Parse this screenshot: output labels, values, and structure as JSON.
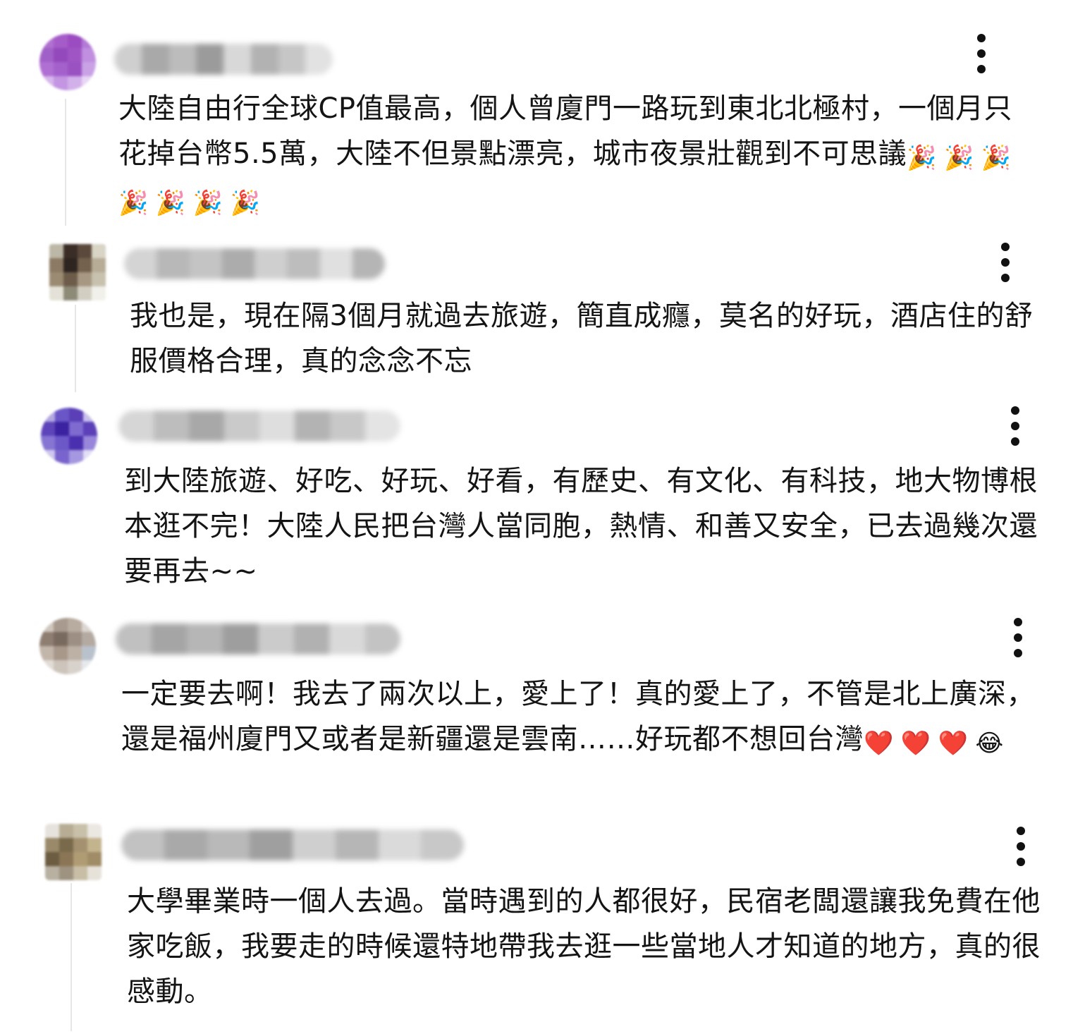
{
  "comments": [
    {
      "text": "大陸自由行全球CP值最高，個人曾廈門一路玩到東北北極村，一個月只花掉台幣5.5萬，大陸不但景點漂亮，城市夜景壯觀到不可思議",
      "emoji": [
        "🎉",
        "🎉",
        "🎉",
        "🎉",
        "🎉",
        "🎉",
        "🎉"
      ]
    },
    {
      "text": "我也是，現在隔3個月就過去旅遊，簡直成癮，莫名的好玩，酒店住的舒服價格合理，真的念念不忘",
      "emoji": []
    },
    {
      "text": "到大陸旅遊、好吃、好玩、好看，有歷史、有文化、有科技，地大物博根本逛不完！大陸人民把台灣人當同胞，熱情、和善又安全，已去過幾次還要再去~~",
      "emoji": []
    },
    {
      "text": "一定要去啊！我去了兩次以上，愛上了！真的愛上了，不管是北上廣深，還是福州廈門又或者是新疆還是雲南……好玩都不想回台灣",
      "emoji": [
        "❤️",
        "❤️",
        "❤️",
        "😂"
      ]
    },
    {
      "text": "大學畢業時一個人去過。當時遇到的人都很好，民宿老闆還讓我免費在他家吃飯，我要走的時候還特地帶我去逛一些當地人才知道的地方，真的很感動。",
      "emoji": []
    }
  ],
  "icons": {
    "menu": "more-vertical-icon"
  }
}
